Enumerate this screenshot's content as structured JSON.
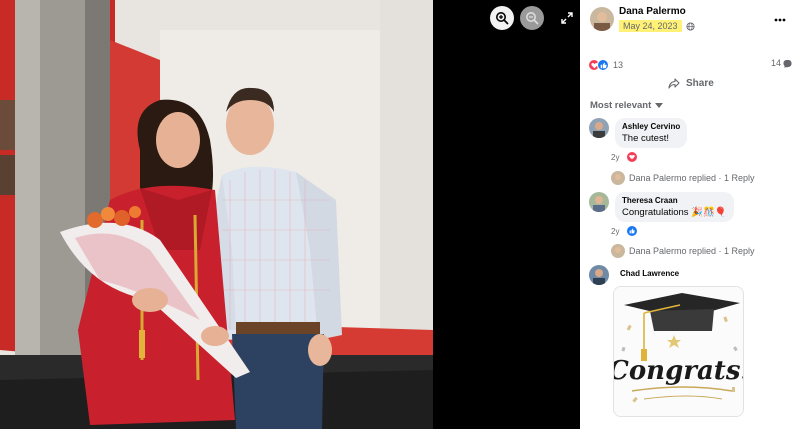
{
  "post": {
    "author": "Dana Palermo",
    "date": "May 24, 2023",
    "reaction_count": "13",
    "comment_count": "14",
    "share_label": "Share",
    "sort_label": "Most relevant"
  },
  "comments": [
    {
      "name": "Ashley Cervino",
      "text": "The cutest!",
      "age": "2y",
      "reaction": "love",
      "reply_summary": "Dana Palermo replied · 1 Reply"
    },
    {
      "name": "Theresa Craan",
      "text": "Congratulations 🎉🎊🎈",
      "age": "2y",
      "reaction": "like",
      "reply_summary": "Dana Palermo replied · 1 Reply"
    },
    {
      "name": "Chad Lawrence",
      "sticker_text": "Congrats!"
    }
  ],
  "colors": {
    "like_blue": "#1877f2",
    "love_red": "#f33e58",
    "date_highlight": "#fff176",
    "bubble_bg": "#f0f2f5",
    "meta_gray": "#65676b"
  },
  "icons": {
    "viewer": [
      "zoom-in-icon",
      "zoom-out-icon",
      "fullscreen-icon"
    ],
    "header": [
      "globe-icon",
      "more-icon"
    ],
    "actions": [
      "share-icon",
      "chevron-down-icon",
      "comment-icon"
    ]
  }
}
